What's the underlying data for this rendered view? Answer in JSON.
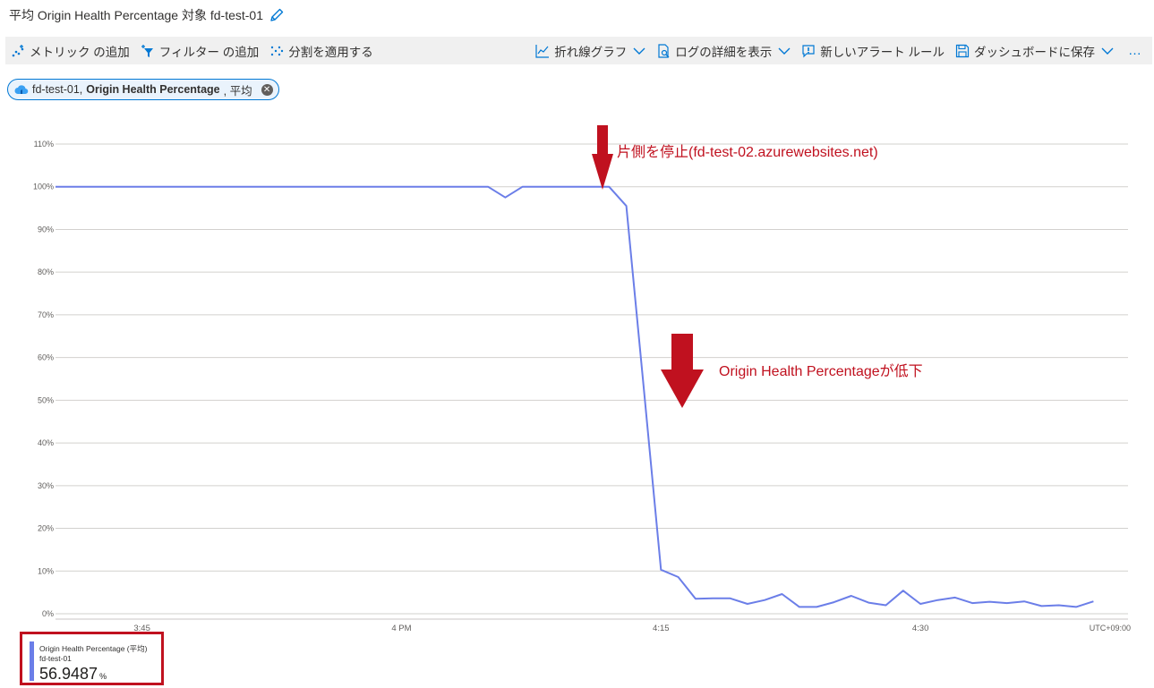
{
  "title": {
    "text": "平均 Origin Health Percentage 対象 fd-test-01"
  },
  "toolbar": {
    "add_metric": "メトリック の追加",
    "add_filter": "フィルター の追加",
    "apply_split": "分割を適用する",
    "line_chart": "折れ線グラフ",
    "log_details": "ログの詳細を表示",
    "new_alert": "新しいアラート ルール",
    "save_dashboard": "ダッシュボードに保存",
    "more": "…"
  },
  "chip": {
    "resource": "fd-test-01,",
    "metric": "Origin Health Percentage",
    "aggregation": ", 平均"
  },
  "annotations": {
    "stop_one_side": "片側を停止(fd-test-02.azurewebsites.net)",
    "percentage_drop": "Origin Health Percentageが低下"
  },
  "legend": {
    "name": "Origin Health Percentage (平均)",
    "resource": "fd-test-01",
    "value": "56.9487",
    "unit": "%"
  },
  "colors": {
    "line": "#6b7ee8",
    "annotation": "#c0111f",
    "grid": "#d2d0ce",
    "accent": "#0078d4"
  },
  "chart_data": {
    "type": "line",
    "y_ticks": [
      "110%",
      "100%",
      "90%",
      "80%",
      "70%",
      "60%",
      "50%",
      "40%",
      "30%",
      "20%",
      "10%",
      "0%"
    ],
    "y_values": [
      110,
      100,
      90,
      80,
      70,
      60,
      50,
      40,
      30,
      20,
      10,
      0
    ],
    "ylim": [
      0,
      110
    ],
    "x_ticks": [
      "3:45",
      "4 PM",
      "4:15",
      "4:30"
    ],
    "x_tick_minutes": [
      -15,
      0,
      15,
      30
    ],
    "timezone": "UTC+09:00",
    "xlim_minutes": [
      -20,
      42
    ],
    "grid": true,
    "series": [
      {
        "x_minutes": [
          -20,
          -19,
          -18,
          -17,
          -16,
          -15,
          -14,
          -13,
          -12,
          -11,
          -10,
          -9,
          -8,
          -7,
          -6,
          -5,
          -4,
          -3,
          -2,
          -1,
          0,
          1,
          2,
          3,
          4,
          5,
          6,
          7,
          8,
          9,
          10,
          11,
          12,
          13,
          14,
          15,
          16,
          17,
          18,
          19,
          20,
          21,
          22,
          23,
          24,
          25,
          26,
          27,
          28,
          29,
          30,
          31,
          32,
          33,
          34,
          35,
          36,
          37,
          38,
          39,
          40
        ],
        "values": [
          100,
          100,
          100,
          100,
          100,
          100,
          100,
          100,
          100,
          100,
          100,
          100,
          100,
          100,
          100,
          100,
          100,
          100,
          100,
          100,
          100,
          100,
          100,
          100,
          100,
          100,
          97.5,
          100,
          100,
          100,
          100,
          100,
          100,
          95.5,
          53,
          10.3,
          8.6,
          3.5,
          3.6,
          3.6,
          2.3,
          3.2,
          4.6,
          1.6,
          1.6,
          2.7,
          4.2,
          2.6,
          2.0,
          5.4,
          2.3,
          3.2,
          3.8,
          2.5,
          2.8,
          2.5,
          2.9,
          1.8,
          2.0,
          1.6,
          2.9
        ]
      }
    ]
  }
}
